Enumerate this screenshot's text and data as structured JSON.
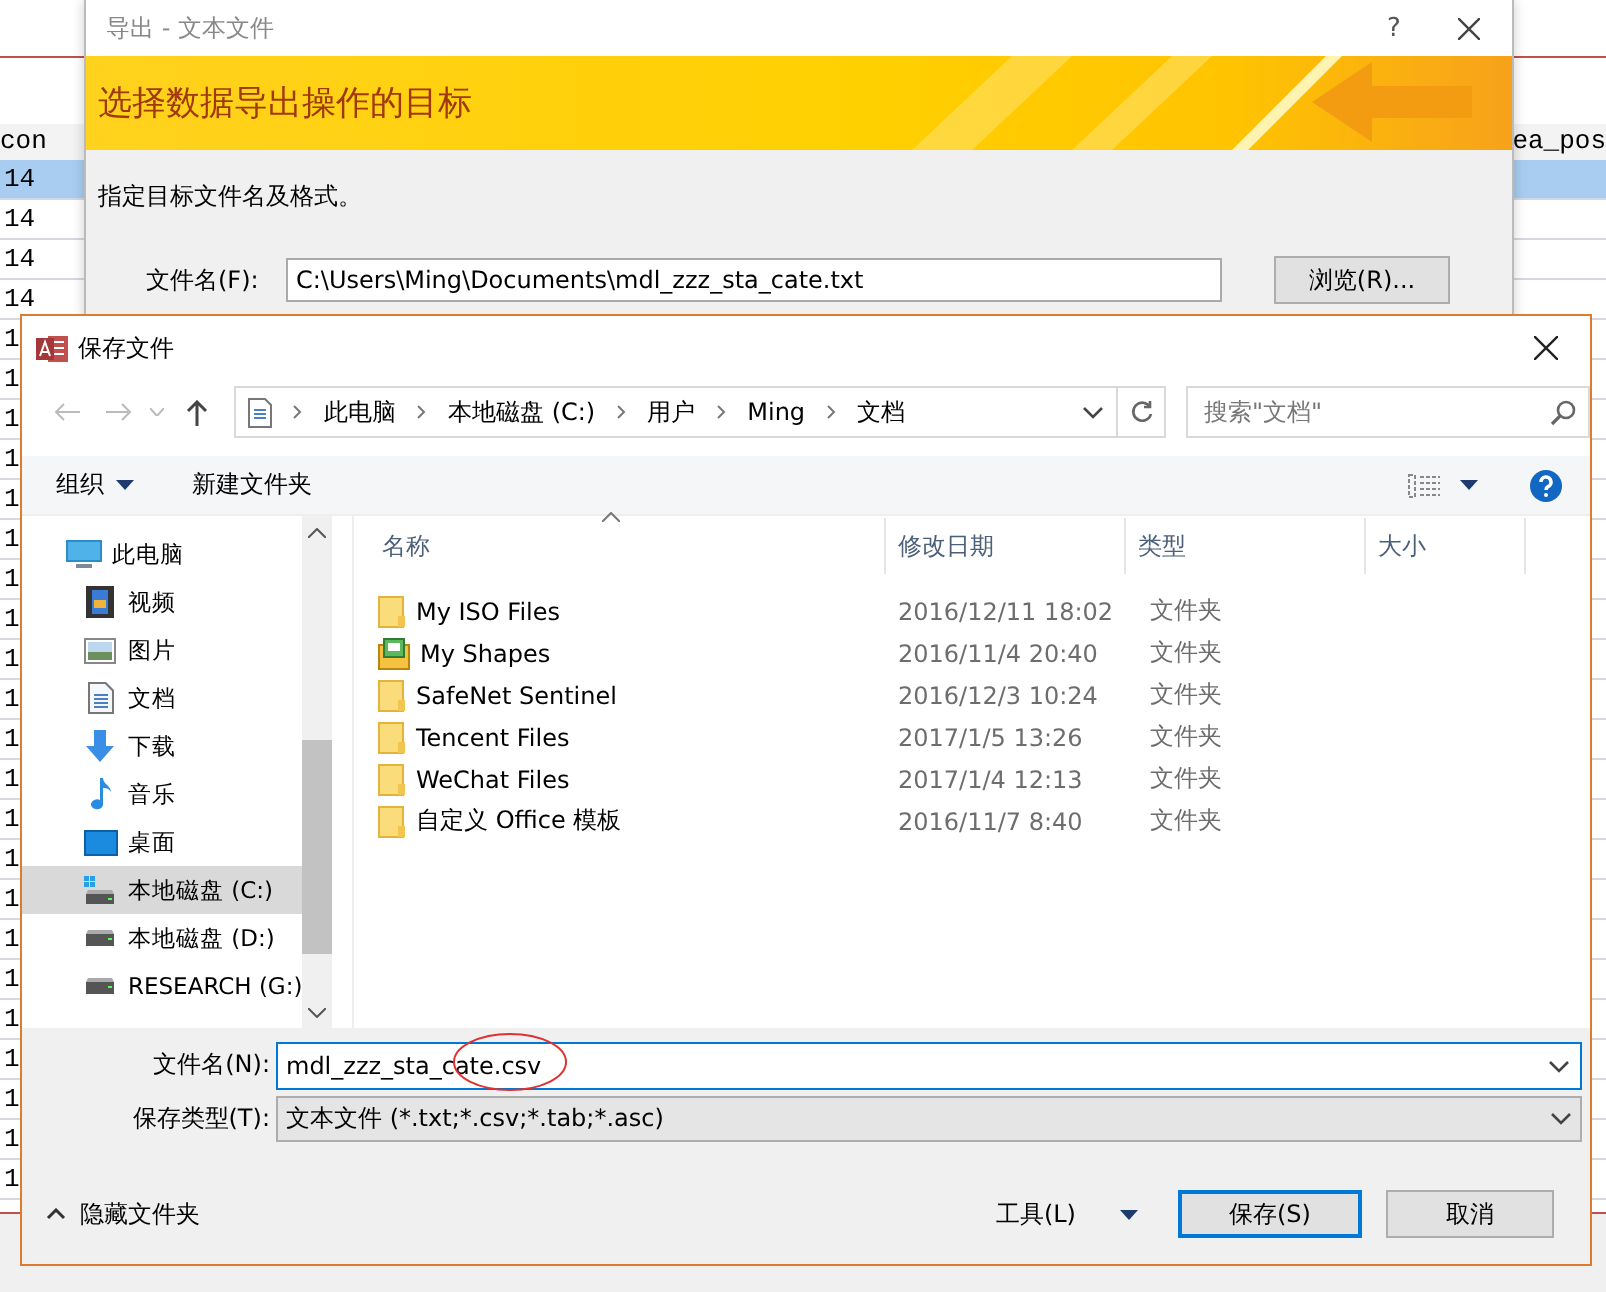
{
  "sheet": {
    "columns": [
      "con",
      "ea_pos"
    ],
    "rows": [
      {
        "cell": "14",
        "selected": true
      },
      {
        "cell": "14",
        "selected": false
      },
      {
        "cell": "14",
        "selected": false
      },
      {
        "cell": "14",
        "selected": false
      },
      {
        "cell": "1",
        "selected": false
      },
      {
        "cell": "1",
        "selected": false
      },
      {
        "cell": "1",
        "selected": false
      },
      {
        "cell": "1",
        "selected": false
      },
      {
        "cell": "1",
        "selected": false
      },
      {
        "cell": "1",
        "selected": false
      },
      {
        "cell": "1",
        "selected": false
      },
      {
        "cell": "1",
        "selected": false
      },
      {
        "cell": "1",
        "selected": false
      },
      {
        "cell": "1",
        "selected": false
      },
      {
        "cell": "1",
        "selected": false
      },
      {
        "cell": "1",
        "selected": false
      },
      {
        "cell": "1",
        "selected": false
      },
      {
        "cell": "1",
        "selected": false
      },
      {
        "cell": "1",
        "selected": false
      },
      {
        "cell": "1",
        "selected": false
      },
      {
        "cell": "1",
        "selected": false
      },
      {
        "cell": "1",
        "selected": false
      },
      {
        "cell": "1",
        "selected": false
      },
      {
        "cell": "1",
        "selected": false
      },
      {
        "cell": "1",
        "selected": false
      },
      {
        "cell": "1",
        "selected": false
      }
    ]
  },
  "export_dialog": {
    "title": "导出 - 文本文件",
    "help": "?",
    "banner": "选择数据导出操作的目标",
    "instruction": "指定目标文件名及格式。",
    "file_label": "文件名(F):",
    "file_value": "C:\\Users\\Ming\\Documents\\mdl_zzz_sta_cate.txt",
    "browse_button": "浏览(R)..."
  },
  "save_dialog": {
    "title": "保存文件",
    "breadcrumb": [
      "此电脑",
      "本地磁盘 (C:)",
      "用户",
      "Ming",
      "文档"
    ],
    "search": {
      "placeholder": "搜索\"文档\""
    },
    "toolbar": {
      "organize": "组织",
      "new_folder": "新建文件夹"
    },
    "nav": [
      {
        "label": "此电脑",
        "kind": "pc",
        "selected": false,
        "children": [
          {
            "label": "视频",
            "kind": "video",
            "selected": false
          },
          {
            "label": "图片",
            "kind": "picture",
            "selected": false
          },
          {
            "label": "文档",
            "kind": "document",
            "selected": false
          },
          {
            "label": "下载",
            "kind": "download",
            "selected": false
          },
          {
            "label": "音乐",
            "kind": "music",
            "selected": false
          },
          {
            "label": "桌面",
            "kind": "desktop",
            "selected": false
          },
          {
            "label": "本地磁盘 (C:)",
            "kind": "system-drive",
            "selected": true
          },
          {
            "label": "本地磁盘 (D:)",
            "kind": "drive",
            "selected": false
          },
          {
            "label": "RESEARCH (G:)",
            "kind": "drive",
            "selected": false
          }
        ]
      }
    ],
    "columns": [
      "名称",
      "修改日期",
      "类型",
      "大小"
    ],
    "files": [
      {
        "name": "My ISO Files",
        "date": "2016/12/11 18:02",
        "type": "文件夹",
        "kind": "folder"
      },
      {
        "name": "My Shapes",
        "date": "2016/11/4 20:40",
        "type": "文件夹",
        "kind": "shapes"
      },
      {
        "name": "SafeNet Sentinel",
        "date": "2016/12/3 10:24",
        "type": "文件夹",
        "kind": "folder"
      },
      {
        "name": "Tencent Files",
        "date": "2017/1/5 13:26",
        "type": "文件夹",
        "kind": "folder"
      },
      {
        "name": "WeChat Files",
        "date": "2017/1/4 12:13",
        "type": "文件夹",
        "kind": "folder"
      },
      {
        "name": "自定义 Office 模板",
        "date": "2016/11/7 8:40",
        "type": "文件夹",
        "kind": "folder"
      }
    ],
    "file_name": {
      "label": "文件名(N):",
      "value": "mdl_zzz_sta_cate.csv"
    },
    "file_type": {
      "label": "保存类型(T):",
      "value": "文本文件 (*.txt;*.csv;*.tab;*.asc)"
    },
    "hide_folders": "隐藏文件夹",
    "tools": "工具(L)",
    "save_button": "保存(S)",
    "cancel_button": "取消"
  }
}
